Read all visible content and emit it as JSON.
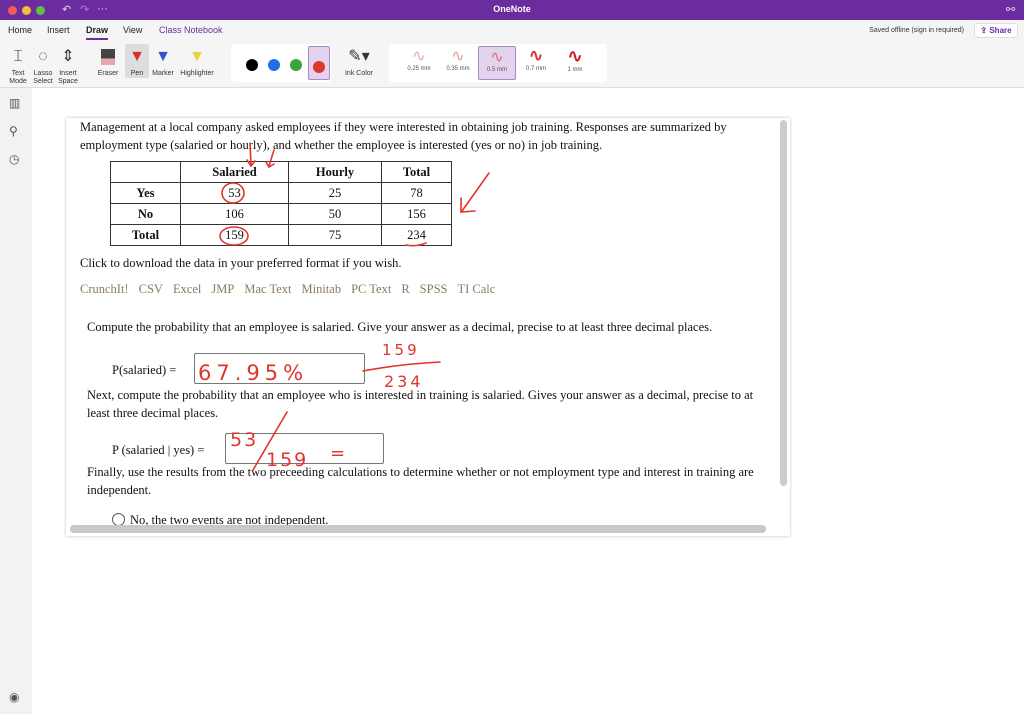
{
  "window": {
    "title": "OneNote",
    "traffic_colors": [
      "#ee5e55",
      "#f5bd3a",
      "#5ac341"
    ]
  },
  "tabs": [
    {
      "label": "Home"
    },
    {
      "label": "Insert"
    },
    {
      "label": "Draw",
      "active": true
    },
    {
      "label": "View"
    },
    {
      "label": "Class Notebook"
    }
  ],
  "status": {
    "saved": "Saved offline (sign in required)",
    "share": "Share"
  },
  "ribbon": {
    "tools": [
      {
        "label": "Text Mode"
      },
      {
        "label": "Lasso Select"
      },
      {
        "label": "Insert Space"
      },
      {
        "label": "Eraser"
      },
      {
        "label": "Pen"
      },
      {
        "label": "Marker"
      },
      {
        "label": "Highlighter"
      }
    ],
    "colors": [
      "#000000",
      "#1f6fe6",
      "#3aa53a",
      "#e0352b"
    ],
    "selected_color": "#e0352b",
    "ink_color": "Ink Color",
    "thickness": [
      {
        "label": "0.25 mm"
      },
      {
        "label": "0.35 mm"
      },
      {
        "label": "0.5 mm",
        "selected": true
      },
      {
        "label": "0.7 mm"
      },
      {
        "label": "1 mm"
      }
    ]
  },
  "content": {
    "intro": "Management at a local company asked employees if they were interested in obtaining job training. Responses are summarized by employment type (salaried or hourly), and whether the employee is interested (yes or no) in job training.",
    "table": {
      "headers": [
        "",
        "Salaried",
        "Hourly",
        "Total"
      ],
      "rows": [
        [
          "Yes",
          "53",
          "25",
          "78"
        ],
        [
          "No",
          "106",
          "50",
          "156"
        ],
        [
          "Total",
          "159",
          "75",
          "234"
        ]
      ]
    },
    "download_text": "Click to download the data in your preferred format if you wish.",
    "formats": [
      "CrunchIt!",
      "CSV",
      "Excel",
      "JMP",
      "Mac Text",
      "Minitab",
      "PC Text",
      "R",
      "SPSS",
      "TI Calc"
    ],
    "q1": "Compute the probability that an employee is salaried. Give your answer as a decimal, precise to at least three decimal places.",
    "q1_label": "P(salaried) =",
    "q2": "Next, compute the probability that an employee who is interested in training is salaried. Gives your answer as a decimal, precise to at least three decimal places.",
    "q2_label": "P (salaried | yes) =",
    "q3": "Finally, use the results from the two preceeding calculations to determine whether or not employment type and interest in training are independent.",
    "option1": "No, the two events are not independent."
  },
  "ink": {
    "color": "#e0352b",
    "a1": "67.95%",
    "a1_num": "159",
    "a1_den": "234",
    "a2_num": "53",
    "a2_den": "159",
    "a2_eq": "="
  }
}
